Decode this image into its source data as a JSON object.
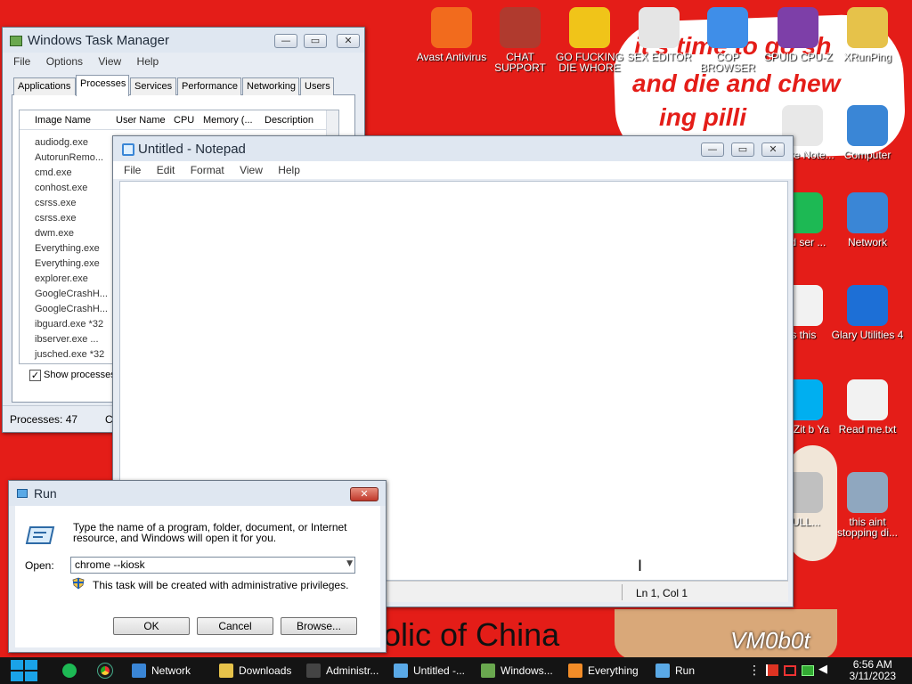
{
  "wallpaper": {
    "text_line1": "it's time to go sh",
    "text_line2": "and die and chew",
    "text_line3": "ing pilli",
    "bottom_text": "olic of China",
    "watermark": "VM0b0t"
  },
  "desktop_icons": [
    {
      "label": "Avast Antivirus",
      "icon": "avast-icon",
      "color": "#f26b1d"
    },
    {
      "label": "CHAT SUPPORT",
      "icon": "doctor-icon",
      "color": "#b03a2e"
    },
    {
      "label": "GO FUCKING DIE WHORE",
      "icon": "de-icon",
      "color": "#f0c419"
    },
    {
      "label": "SEX EDITOR",
      "icon": "hxd-icon",
      "color": "#e5e5e5"
    },
    {
      "label": "COP BROWSER",
      "icon": "chromium-icon",
      "color": "#3f8ee8"
    },
    {
      "label": "CPUID CPU-Z",
      "icon": "cpuz-icon",
      "color": "#7d3fa8"
    },
    {
      "label": "XRunPing",
      "icon": "folder-user-icon",
      "color": "#e6c24a"
    },
    {
      "label": "Computer",
      "icon": "computer-icon",
      "color": "#3a86d6"
    },
    {
      "label": "Network",
      "icon": "network-icon",
      "color": "#3a86d6"
    },
    {
      "label": "Glary Utilities 4",
      "icon": "glary-icon",
      "color": "#1d6fd6"
    },
    {
      "label": "Read me.txt",
      "icon": "textfile-icon",
      "color": "#f2f2f2"
    },
    {
      "label": "this aint stopping di...",
      "icon": "computer-icon",
      "color": "#8fa7bf"
    },
    {
      "label": "eware Note...",
      "icon": "note-icon",
      "color": "#e8e8e8"
    },
    {
      "label": "sed ser ...",
      "icon": "spotify-icon",
      "color": "#1db954"
    },
    {
      "label": "is this",
      "icon": "doc-icon",
      "color": "#f2f2f2"
    },
    {
      "label": "hat Zit b Ya",
      "icon": "skype-icon",
      "color": "#00aff0"
    },
    {
      "label": "BULL...",
      "icon": "disc-icon",
      "color": "#c0c0c0"
    }
  ],
  "taskmgr": {
    "title": "Windows Task Manager",
    "menu": [
      "File",
      "Options",
      "View",
      "Help"
    ],
    "tabs": [
      "Applications",
      "Processes",
      "Services",
      "Performance",
      "Networking",
      "Users"
    ],
    "active_tab": "Processes",
    "columns": [
      "Image Name",
      "User Name",
      "CPU",
      "Memory (...",
      "Description"
    ],
    "processes": [
      "audiodg.exe",
      "AutorunRemo...",
      "cmd.exe",
      "conhost.exe",
      "csrss.exe",
      "csrss.exe",
      "dwm.exe",
      "Everything.exe",
      "Everything.exe",
      "explorer.exe",
      "GoogleCrashH...",
      "GoogleCrashH...",
      "ibguard.exe *32",
      "ibserver.exe ...",
      "jusched.exe *32"
    ],
    "show_processes": "Show processes",
    "status_processes": "Processes: 47",
    "status_cpu": "C"
  },
  "notepad": {
    "title": "Untitled - Notepad",
    "menu": [
      "File",
      "Edit",
      "Format",
      "View",
      "Help"
    ],
    "status_position": "Ln 1, Col 1"
  },
  "run": {
    "title": "Run",
    "description": "Type the name of a program, folder, document, or Internet resource, and Windows will open it for you.",
    "open_label": "Open:",
    "input_value": "chrome --kiosk",
    "admin_note": "This task will be created with administrative privileges.",
    "ok": "OK",
    "cancel": "Cancel",
    "browse": "Browse..."
  },
  "taskbar": {
    "items": [
      {
        "label": "Network",
        "icon": "network-icon",
        "color": "#3a86d6"
      },
      {
        "label": "Downloads",
        "icon": "folder-icon",
        "color": "#e6c24a"
      },
      {
        "label": "Administr...",
        "icon": "cmd-icon",
        "color": "#444444"
      },
      {
        "label": "Untitled -...",
        "icon": "notepad-icon",
        "color": "#5aa9e6"
      },
      {
        "label": "Windows...",
        "icon": "taskmgr-icon",
        "color": "#6aa84f"
      },
      {
        "label": "Everything",
        "icon": "everything-icon",
        "color": "#f28c28"
      },
      {
        "label": "Run",
        "icon": "run-icon",
        "color": "#5aa9e6"
      }
    ],
    "time": "6:56 AM",
    "date": "3/11/2023"
  }
}
